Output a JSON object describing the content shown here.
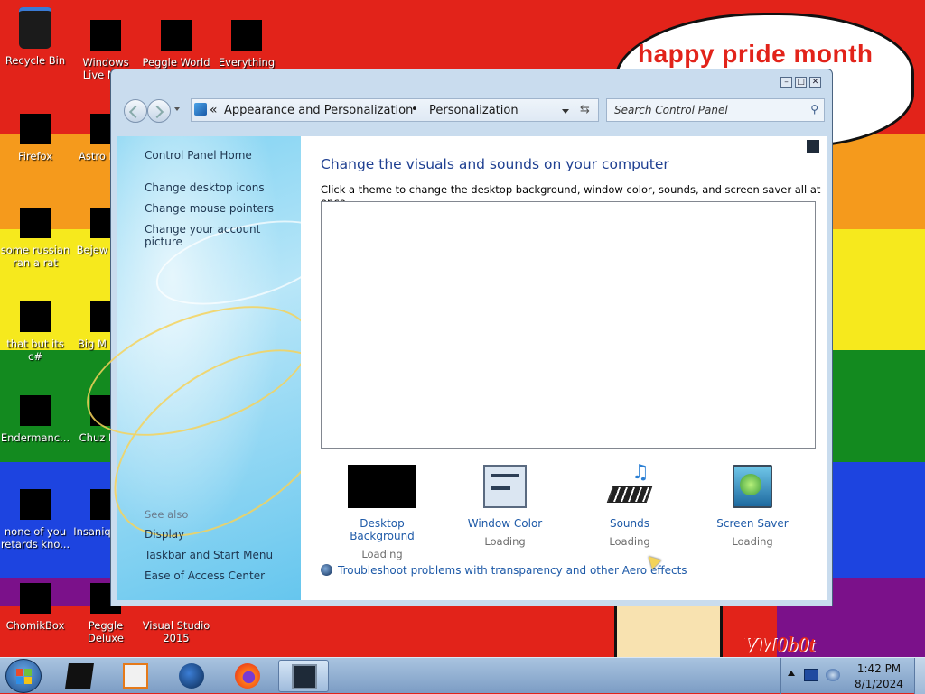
{
  "wallpaper": {
    "bubble_text": "happy pride month",
    "watermark": "VM0b0t",
    "colors": [
      "#e2231a",
      "#f59a1c",
      "#f6e91d",
      "#138a1f",
      "#1d44e0",
      "#7b118a"
    ]
  },
  "desktop_icons": [
    {
      "label": "Recycle Bin",
      "icon": "recycle-bin-icon"
    },
    {
      "label": "Windows Live Mail",
      "icon": "mail-icon"
    },
    {
      "label": "Peggle World",
      "icon": "game-icon"
    },
    {
      "label": "Everything",
      "icon": "search-app-icon"
    },
    {
      "label": "Firefox",
      "icon": "firefox-icon"
    },
    {
      "label": "Astro Delu",
      "icon": "game-icon"
    },
    {
      "label": "some russian ran a rat",
      "icon": "app-icon"
    },
    {
      "label": "Bejew Delu",
      "icon": "game-icon"
    },
    {
      "label": "that but its c#",
      "icon": "app-icon"
    },
    {
      "label": "Big M Delu",
      "icon": "game-icon"
    },
    {
      "label": "Endermanc...",
      "icon": "app-icon"
    },
    {
      "label": "Chuz Delu",
      "icon": "game-icon"
    },
    {
      "label": "none of you retards kno...",
      "icon": "app-icon"
    },
    {
      "label": "Insaniq Delu",
      "icon": "game-icon"
    },
    {
      "label": "ChomikBox",
      "icon": "app-icon"
    },
    {
      "label": "Peggle Deluxe",
      "icon": "game-icon"
    },
    {
      "label": "Visual Studio 2015",
      "icon": "visual-studio-icon"
    }
  ],
  "window": {
    "address": {
      "crumb1": "Appearance and Personalization",
      "crumb2": "Personalization",
      "separator_left": "«",
      "separator_mid": "•"
    },
    "search_placeholder": "Search Control Panel",
    "left_pane": {
      "home": "Control Panel Home",
      "links": [
        "Change desktop icons",
        "Change mouse pointers",
        "Change your account picture"
      ],
      "see_also_title": "See also",
      "see_also": [
        "Display",
        "Taskbar and Start Menu",
        "Ease of Access Center"
      ]
    },
    "main": {
      "heading": "Change the visuals and sounds on your computer",
      "description": "Click a theme to change the desktop background, window color, sounds, and screen saver all at once.",
      "tools": [
        {
          "label": "Desktop Background",
          "status": "Loading"
        },
        {
          "label": "Window Color",
          "status": "Loading"
        },
        {
          "label": "Sounds",
          "status": "Loading"
        },
        {
          "label": "Screen Saver",
          "status": "Loading"
        }
      ],
      "troubleshoot_link": "Troubleshoot problems with transparency and other Aero effects"
    },
    "title_buttons": {
      "minimize": "–",
      "maximize": "□",
      "close": "✕"
    }
  },
  "taskbar": {
    "clock_time": "1:42 PM",
    "clock_date": "8/1/2024"
  }
}
